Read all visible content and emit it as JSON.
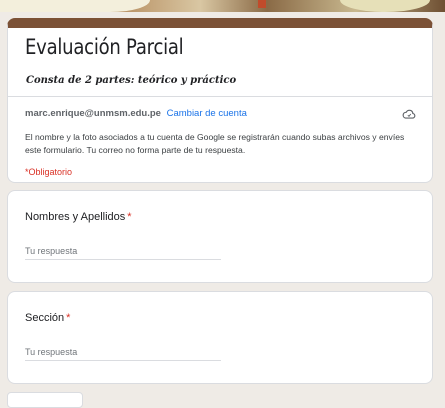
{
  "form": {
    "title": "Evaluación Parcial",
    "subtitle": "Consta de 2 partes: teórico y práctico",
    "account_email": "marc.enrique@unmsm.edu.pe",
    "switch_account": "Cambiar de cuenta",
    "notice": "El nombre y la foto asociados a tu cuenta de Google se registrarán cuando subas archivos y envíes este formulario. Tu correo no forma parte de tu respuesta.",
    "required_note": "*Obligatorio",
    "icons": {
      "save_status": "cloud-icon"
    },
    "colors": {
      "accent": "#7b5136",
      "required": "#d93025",
      "link": "#1a73e8"
    }
  },
  "questions": [
    {
      "label": "Nombres y Apellidos",
      "required_mark": "*",
      "placeholder": "Tu respuesta"
    },
    {
      "label": "Sección",
      "required_mark": "*",
      "placeholder": "Tu respuesta"
    }
  ]
}
